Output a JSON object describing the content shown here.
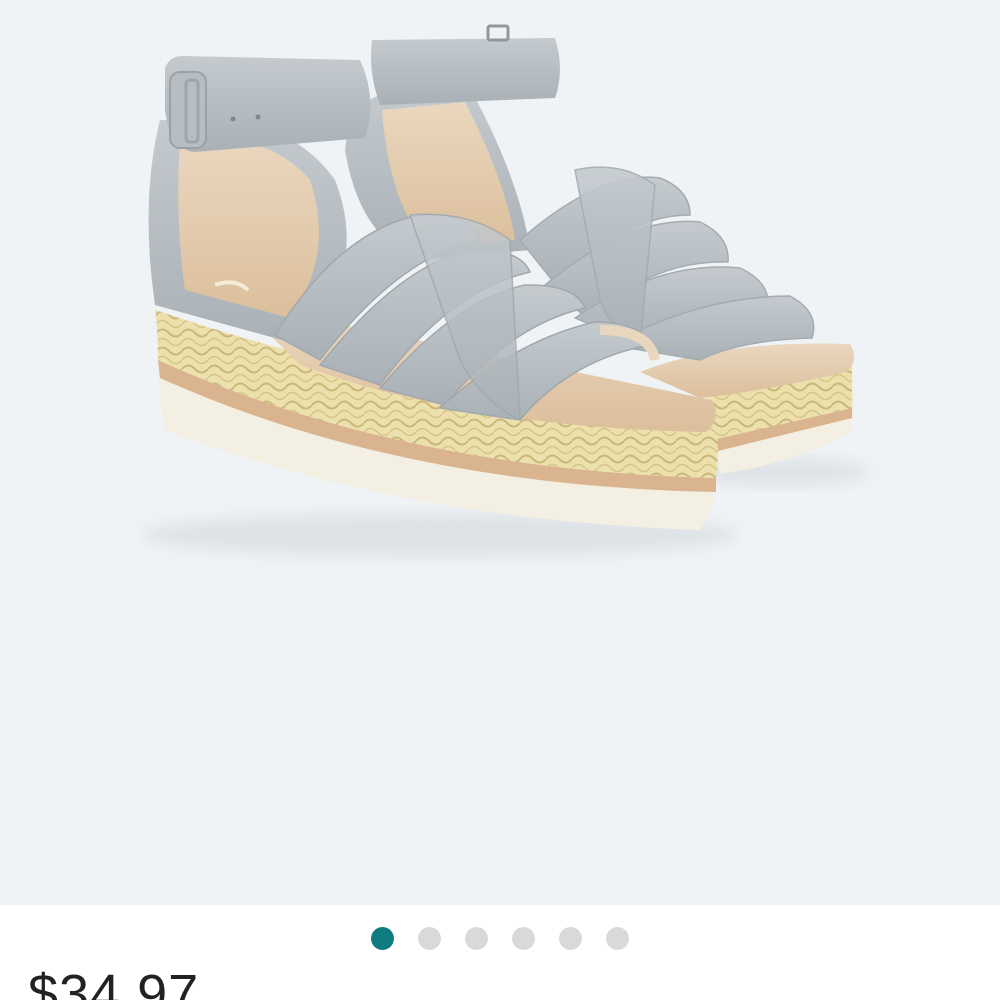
{
  "product": {
    "image": {
      "subject": "sandal-icon",
      "colors": {
        "background": "#f0f3f6",
        "suede": "#b9c0c5",
        "raffia": "#e9dca6",
        "sole": "#f3efe2",
        "lining": "#e6cdb0"
      }
    },
    "carousel": {
      "total": 6,
      "active_index": 0,
      "active_color": "#0f7d7f",
      "inactive_color": "#d9d9dc"
    },
    "price": "$34.97"
  }
}
